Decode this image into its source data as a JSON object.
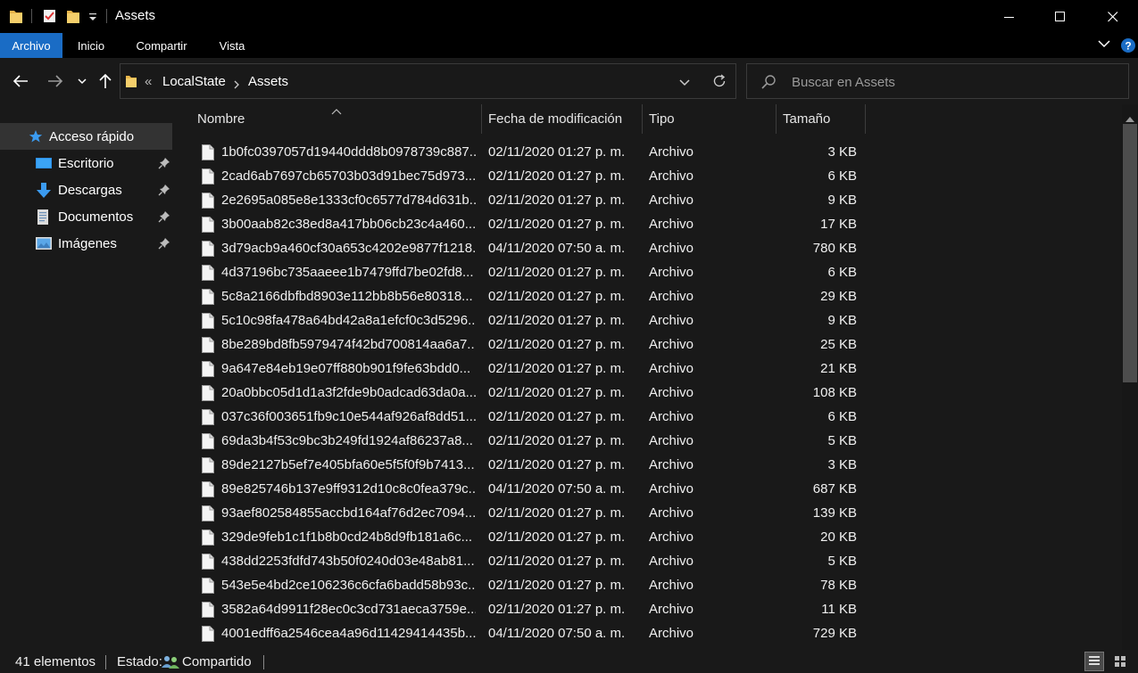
{
  "window": {
    "title": "Assets"
  },
  "ribbon": {
    "tabs": [
      "Archivo",
      "Inicio",
      "Compartir",
      "Vista"
    ],
    "active_tab": "Archivo"
  },
  "address": {
    "overflow": "«",
    "crumbs": [
      "LocalState",
      "Assets"
    ]
  },
  "search": {
    "placeholder": "Buscar en Assets"
  },
  "nav": {
    "items": [
      {
        "label": "Acceso rápido",
        "icon": "star-icon",
        "pinned": false
      },
      {
        "label": "Escritorio",
        "icon": "desktop-icon",
        "pinned": true
      },
      {
        "label": "Descargas",
        "icon": "download-arrow-icon",
        "pinned": true
      },
      {
        "label": "Documentos",
        "icon": "document-icon",
        "pinned": true
      },
      {
        "label": "Imágenes",
        "icon": "pictures-icon",
        "pinned": true
      }
    ]
  },
  "columns": {
    "name": "Nombre",
    "date": "Fecha de modificación",
    "type": "Tipo",
    "size": "Tamaño"
  },
  "files": [
    {
      "name": "1b0fc0397057d19440ddd8b0978739c887...",
      "date": "02/11/2020 01:27 p. m.",
      "type": "Archivo",
      "size": "3 KB"
    },
    {
      "name": "2cad6ab7697cb65703b03d91bec75d973...",
      "date": "02/11/2020 01:27 p. m.",
      "type": "Archivo",
      "size": "6 KB"
    },
    {
      "name": "2e2695a085e8e1333cf0c6577d784d631b...",
      "date": "02/11/2020 01:27 p. m.",
      "type": "Archivo",
      "size": "9 KB"
    },
    {
      "name": "3b00aab82c38ed8a417bb06cb23c4a460...",
      "date": "02/11/2020 01:27 p. m.",
      "type": "Archivo",
      "size": "17 KB"
    },
    {
      "name": "3d79acb9a460cf30a653c4202e9877f1218...",
      "date": "04/11/2020 07:50 a. m.",
      "type": "Archivo",
      "size": "780 KB"
    },
    {
      "name": "4d37196bc735aaeee1b7479ffd7be02fd8...",
      "date": "02/11/2020 01:27 p. m.",
      "type": "Archivo",
      "size": "6 KB"
    },
    {
      "name": "5c8a2166dbfbd8903e112bb8b56e80318...",
      "date": "02/11/2020 01:27 p. m.",
      "type": "Archivo",
      "size": "29 KB"
    },
    {
      "name": "5c10c98fa478a64bd42a8a1efcf0c3d5296...",
      "date": "02/11/2020 01:27 p. m.",
      "type": "Archivo",
      "size": "9 KB"
    },
    {
      "name": "8be289bd8fb5979474f42bd700814aa6a7...",
      "date": "02/11/2020 01:27 p. m.",
      "type": "Archivo",
      "size": "25 KB"
    },
    {
      "name": "9a647e84eb19e07ff880b901f9fe63bdd0...",
      "date": "02/11/2020 01:27 p. m.",
      "type": "Archivo",
      "size": "21 KB"
    },
    {
      "name": "20a0bbc05d1d1a3f2fde9b0adcad63da0a...",
      "date": "02/11/2020 01:27 p. m.",
      "type": "Archivo",
      "size": "108 KB"
    },
    {
      "name": "037c36f003651fb9c10e544af926af8dd51...",
      "date": "02/11/2020 01:27 p. m.",
      "type": "Archivo",
      "size": "6 KB"
    },
    {
      "name": "69da3b4f53c9bc3b249fd1924af86237a8...",
      "date": "02/11/2020 01:27 p. m.",
      "type": "Archivo",
      "size": "5 KB"
    },
    {
      "name": "89de2127b5ef7e405bfa60e5f5f0f9b7413...",
      "date": "02/11/2020 01:27 p. m.",
      "type": "Archivo",
      "size": "3 KB"
    },
    {
      "name": "89e825746b137e9ff9312d10c8c0fea379c...",
      "date": "04/11/2020 07:50 a. m.",
      "type": "Archivo",
      "size": "687 KB"
    },
    {
      "name": "93aef802584855accbd164af76d2ec7094...",
      "date": "02/11/2020 01:27 p. m.",
      "type": "Archivo",
      "size": "139 KB"
    },
    {
      "name": "329de9feb1c1f1b8b0cd24b8d9fb181a6c...",
      "date": "02/11/2020 01:27 p. m.",
      "type": "Archivo",
      "size": "20 KB"
    },
    {
      "name": "438dd2253fdfd743b50f0240d03e48ab81...",
      "date": "02/11/2020 01:27 p. m.",
      "type": "Archivo",
      "size": "5 KB"
    },
    {
      "name": "543e5e4bd2ce106236c6cfa6badd58b93c...",
      "date": "02/11/2020 01:27 p. m.",
      "type": "Archivo",
      "size": "78 KB"
    },
    {
      "name": "3582a64d9911f28ec0c3cd731aeca3759e...",
      "date": "02/11/2020 01:27 p. m.",
      "type": "Archivo",
      "size": "11 KB"
    },
    {
      "name": "4001edff6a2546cea4a96d11429414435b...",
      "date": "04/11/2020 07:50 a. m.",
      "type": "Archivo",
      "size": "729 KB"
    }
  ],
  "status": {
    "count": "41 elementos",
    "state_label": "Estado:",
    "state_value": "Compartido"
  },
  "colors": {
    "accent": "#1a6cc5",
    "background": "#191919",
    "titlebar": "#000000"
  }
}
